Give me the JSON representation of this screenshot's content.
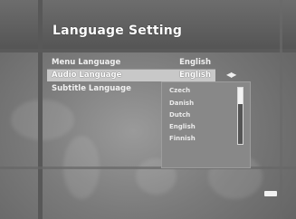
{
  "window": {
    "title": "Language Setting"
  },
  "settings": [
    {
      "label": "Menu Language",
      "value": "English",
      "selected": false
    },
    {
      "label": "Audio Language",
      "value": "English",
      "selected": true
    },
    {
      "label": "Subtitle Language",
      "value": "",
      "selected": false
    }
  ],
  "dropdown": {
    "options": [
      "Czech",
      "Danish",
      "Dutch",
      "English",
      "Finnish"
    ]
  },
  "nav": {
    "arrows_icon": "left-right-arrows-icon"
  },
  "colors": {
    "background": "#7a7a7a",
    "highlight": "#c8c8c8",
    "text": "#ffffff"
  }
}
